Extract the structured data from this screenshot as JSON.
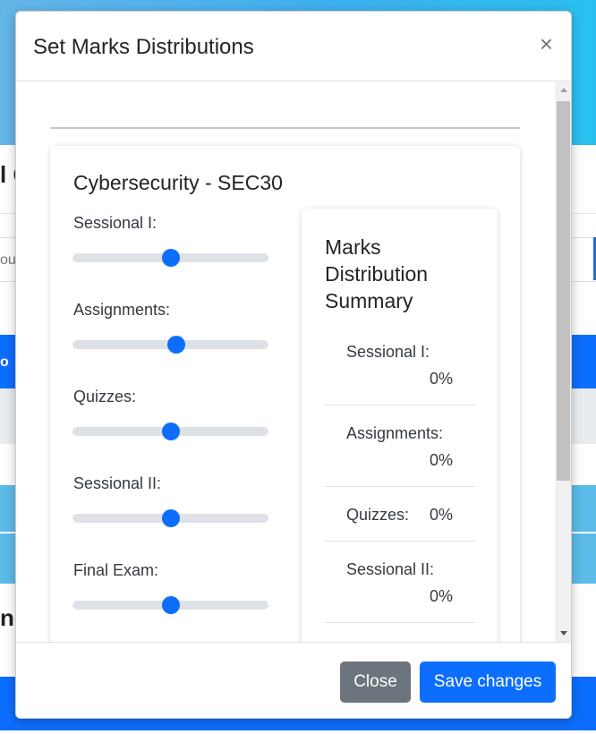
{
  "background": {
    "title_fragment": "l C",
    "input_fragment": "ou",
    "bar_fragment": "o",
    "bottom_fragment": "nc"
  },
  "modal": {
    "title": "Set Marks Distributions",
    "close_glyph": "×",
    "course_title": "Cybersecurity - SEC30",
    "sliders": [
      {
        "label": "Sessional I:",
        "value_fraction": 0.5
      },
      {
        "label": "Assignments:",
        "value_fraction": 0.53
      },
      {
        "label": "Quizzes:",
        "value_fraction": 0.5
      },
      {
        "label": "Sessional II:",
        "value_fraction": 0.5
      },
      {
        "label": "Final Exam:",
        "value_fraction": 0.5
      }
    ],
    "summary": {
      "title": "Marks Distribution Summary",
      "rows": [
        {
          "label": "Sessional I:",
          "value": "0%"
        },
        {
          "label": "Assignments:",
          "value": "0%"
        },
        {
          "label": "Quizzes:",
          "value": "0%"
        },
        {
          "label": "Sessional II:",
          "value": "0%"
        }
      ]
    },
    "footer": {
      "close_label": "Close",
      "save_label": "Save changes"
    }
  },
  "colors": {
    "primary": "#0d6efd",
    "secondary": "#6c757d",
    "track": "#dee2e6"
  }
}
